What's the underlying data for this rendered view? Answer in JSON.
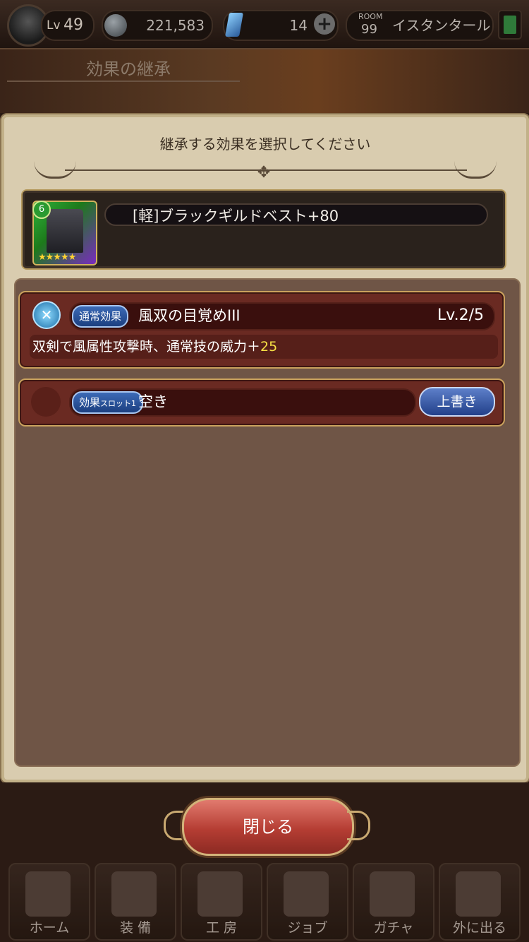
{
  "status": {
    "level_tag": "Lv",
    "level": "49",
    "gil": "221,583",
    "gems": "14",
    "room_label": "ROOM",
    "room_number": "99",
    "location": "イスタンタール"
  },
  "screen_title": "効果の継承",
  "modal": {
    "instruction": "継承する効果を選択してください",
    "item": {
      "rarity_badge": "6",
      "stars": "★★★★★",
      "name": "[軽]ブラックギルドベスト+80"
    },
    "effect": {
      "tag": "通常効果",
      "name": "風双の目覚めIII",
      "level": "Lv.2/5",
      "desc_prefix": "双剣で風属性攻撃時、通常技の威力＋",
      "desc_value": "25"
    },
    "slot": {
      "tag_main": "効果",
      "tag_sub": "スロット1",
      "value": "空き",
      "overwrite_label": "上書き"
    }
  },
  "close_label": "閉じる",
  "nav": [
    {
      "label": "ホーム"
    },
    {
      "label": "装 備"
    },
    {
      "label": "工 房"
    },
    {
      "label": "ジョブ"
    },
    {
      "label": "ガチャ"
    },
    {
      "label": "外に出る"
    }
  ]
}
